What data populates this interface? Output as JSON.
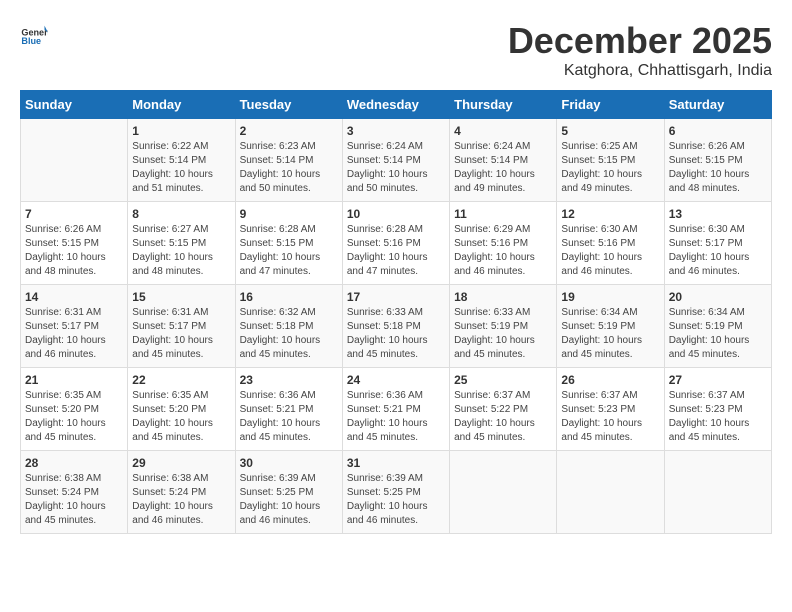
{
  "header": {
    "logo_general": "General",
    "logo_blue": "Blue",
    "month": "December 2025",
    "location": "Katghora, Chhattisgarh, India"
  },
  "days_of_week": [
    "Sunday",
    "Monday",
    "Tuesday",
    "Wednesday",
    "Thursday",
    "Friday",
    "Saturday"
  ],
  "weeks": [
    [
      {
        "num": "",
        "info": ""
      },
      {
        "num": "1",
        "info": "Sunrise: 6:22 AM\nSunset: 5:14 PM\nDaylight: 10 hours\nand 51 minutes."
      },
      {
        "num": "2",
        "info": "Sunrise: 6:23 AM\nSunset: 5:14 PM\nDaylight: 10 hours\nand 50 minutes."
      },
      {
        "num": "3",
        "info": "Sunrise: 6:24 AM\nSunset: 5:14 PM\nDaylight: 10 hours\nand 50 minutes."
      },
      {
        "num": "4",
        "info": "Sunrise: 6:24 AM\nSunset: 5:14 PM\nDaylight: 10 hours\nand 49 minutes."
      },
      {
        "num": "5",
        "info": "Sunrise: 6:25 AM\nSunset: 5:15 PM\nDaylight: 10 hours\nand 49 minutes."
      },
      {
        "num": "6",
        "info": "Sunrise: 6:26 AM\nSunset: 5:15 PM\nDaylight: 10 hours\nand 48 minutes."
      }
    ],
    [
      {
        "num": "7",
        "info": "Sunrise: 6:26 AM\nSunset: 5:15 PM\nDaylight: 10 hours\nand 48 minutes."
      },
      {
        "num": "8",
        "info": "Sunrise: 6:27 AM\nSunset: 5:15 PM\nDaylight: 10 hours\nand 48 minutes."
      },
      {
        "num": "9",
        "info": "Sunrise: 6:28 AM\nSunset: 5:15 PM\nDaylight: 10 hours\nand 47 minutes."
      },
      {
        "num": "10",
        "info": "Sunrise: 6:28 AM\nSunset: 5:16 PM\nDaylight: 10 hours\nand 47 minutes."
      },
      {
        "num": "11",
        "info": "Sunrise: 6:29 AM\nSunset: 5:16 PM\nDaylight: 10 hours\nand 46 minutes."
      },
      {
        "num": "12",
        "info": "Sunrise: 6:30 AM\nSunset: 5:16 PM\nDaylight: 10 hours\nand 46 minutes."
      },
      {
        "num": "13",
        "info": "Sunrise: 6:30 AM\nSunset: 5:17 PM\nDaylight: 10 hours\nand 46 minutes."
      }
    ],
    [
      {
        "num": "14",
        "info": "Sunrise: 6:31 AM\nSunset: 5:17 PM\nDaylight: 10 hours\nand 46 minutes."
      },
      {
        "num": "15",
        "info": "Sunrise: 6:31 AM\nSunset: 5:17 PM\nDaylight: 10 hours\nand 45 minutes."
      },
      {
        "num": "16",
        "info": "Sunrise: 6:32 AM\nSunset: 5:18 PM\nDaylight: 10 hours\nand 45 minutes."
      },
      {
        "num": "17",
        "info": "Sunrise: 6:33 AM\nSunset: 5:18 PM\nDaylight: 10 hours\nand 45 minutes."
      },
      {
        "num": "18",
        "info": "Sunrise: 6:33 AM\nSunset: 5:19 PM\nDaylight: 10 hours\nand 45 minutes."
      },
      {
        "num": "19",
        "info": "Sunrise: 6:34 AM\nSunset: 5:19 PM\nDaylight: 10 hours\nand 45 minutes."
      },
      {
        "num": "20",
        "info": "Sunrise: 6:34 AM\nSunset: 5:19 PM\nDaylight: 10 hours\nand 45 minutes."
      }
    ],
    [
      {
        "num": "21",
        "info": "Sunrise: 6:35 AM\nSunset: 5:20 PM\nDaylight: 10 hours\nand 45 minutes."
      },
      {
        "num": "22",
        "info": "Sunrise: 6:35 AM\nSunset: 5:20 PM\nDaylight: 10 hours\nand 45 minutes."
      },
      {
        "num": "23",
        "info": "Sunrise: 6:36 AM\nSunset: 5:21 PM\nDaylight: 10 hours\nand 45 minutes."
      },
      {
        "num": "24",
        "info": "Sunrise: 6:36 AM\nSunset: 5:21 PM\nDaylight: 10 hours\nand 45 minutes."
      },
      {
        "num": "25",
        "info": "Sunrise: 6:37 AM\nSunset: 5:22 PM\nDaylight: 10 hours\nand 45 minutes."
      },
      {
        "num": "26",
        "info": "Sunrise: 6:37 AM\nSunset: 5:23 PM\nDaylight: 10 hours\nand 45 minutes."
      },
      {
        "num": "27",
        "info": "Sunrise: 6:37 AM\nSunset: 5:23 PM\nDaylight: 10 hours\nand 45 minutes."
      }
    ],
    [
      {
        "num": "28",
        "info": "Sunrise: 6:38 AM\nSunset: 5:24 PM\nDaylight: 10 hours\nand 45 minutes."
      },
      {
        "num": "29",
        "info": "Sunrise: 6:38 AM\nSunset: 5:24 PM\nDaylight: 10 hours\nand 46 minutes."
      },
      {
        "num": "30",
        "info": "Sunrise: 6:39 AM\nSunset: 5:25 PM\nDaylight: 10 hours\nand 46 minutes."
      },
      {
        "num": "31",
        "info": "Sunrise: 6:39 AM\nSunset: 5:25 PM\nDaylight: 10 hours\nand 46 minutes."
      },
      {
        "num": "",
        "info": ""
      },
      {
        "num": "",
        "info": ""
      },
      {
        "num": "",
        "info": ""
      }
    ]
  ]
}
